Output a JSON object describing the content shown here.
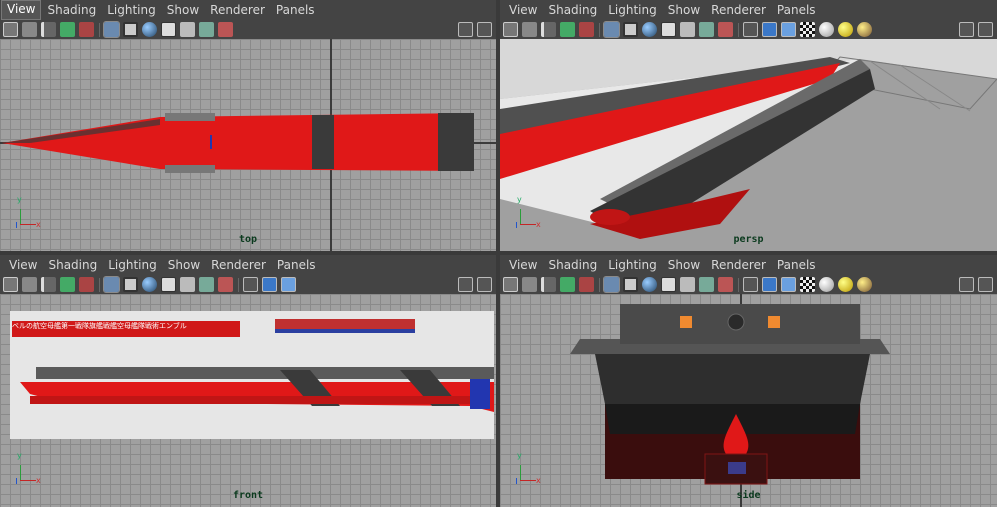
{
  "menus": [
    "View",
    "Shading",
    "Lighting",
    "Show",
    "Renderer",
    "Panels"
  ],
  "panes": [
    {
      "id": "top",
      "label": "top"
    },
    {
      "id": "persp",
      "label": "persp"
    },
    {
      "id": "front",
      "label": "front"
    },
    {
      "id": "side",
      "label": "side"
    }
  ],
  "front_banner_text": "ベルの航空母艦第一戦隊旗艦戦艦空母艦隊戦術エンブル",
  "axis": {
    "x_label": "x",
    "y_label": "y"
  },
  "colors": {
    "hull_red": "#e01818",
    "hull_dark": "#3a3a3a",
    "viewport_bg": "#a0a0a0",
    "panel_bg": "#444444",
    "label_green": "#0b3a1e"
  }
}
